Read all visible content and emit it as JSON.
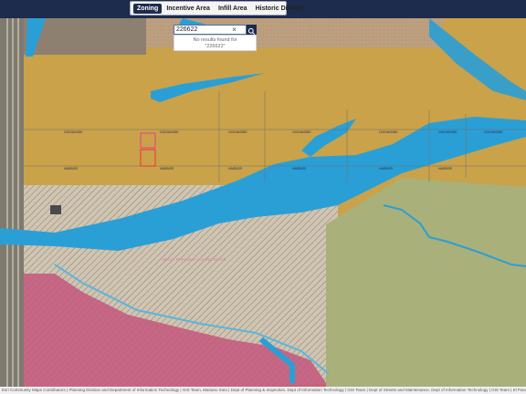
{
  "tabs": [
    {
      "label": "Zoning",
      "active": true
    },
    {
      "label": "Incentive Area",
      "active": false
    },
    {
      "label": "Infill Area",
      "active": false
    },
    {
      "label": "Historic District",
      "active": false
    }
  ],
  "search": {
    "value": "226622",
    "no_results_line1": "No results found for",
    "no_results_line2": "\"226622\""
  },
  "map": {
    "street_labels": [
      "OCEANSIDE",
      "OCEANSIDE",
      "OCEANSIDE",
      "OCEANSIDE",
      "OCEANSIDE",
      "OCEANSIDE",
      "OCEANSIDE",
      "HARBOR",
      "HARBOR",
      "HARBOR",
      "HARBOR",
      "HARBOR",
      "HARBOR"
    ],
    "parcel_label": "DELTA PARKWAY / CHINO DRIVE",
    "colors": {
      "zoning_orange": "#c9a24a",
      "water_blue": "#2a9fd6",
      "residential_pink": "#c4577c",
      "open_green": "#a9b07a",
      "nav_dark": "#1d2b4d"
    }
  },
  "attribution": "Esri Community Maps Contributors | Planning Division and Department of Information Technology | GIS Team, Mariano Soto | Dept of Planning & Inspection, Dept of Information Technology | GIS Team | Dept of Streets and Maintenance, Dept of Information Technology | GIS Team | El Paso MPO"
}
